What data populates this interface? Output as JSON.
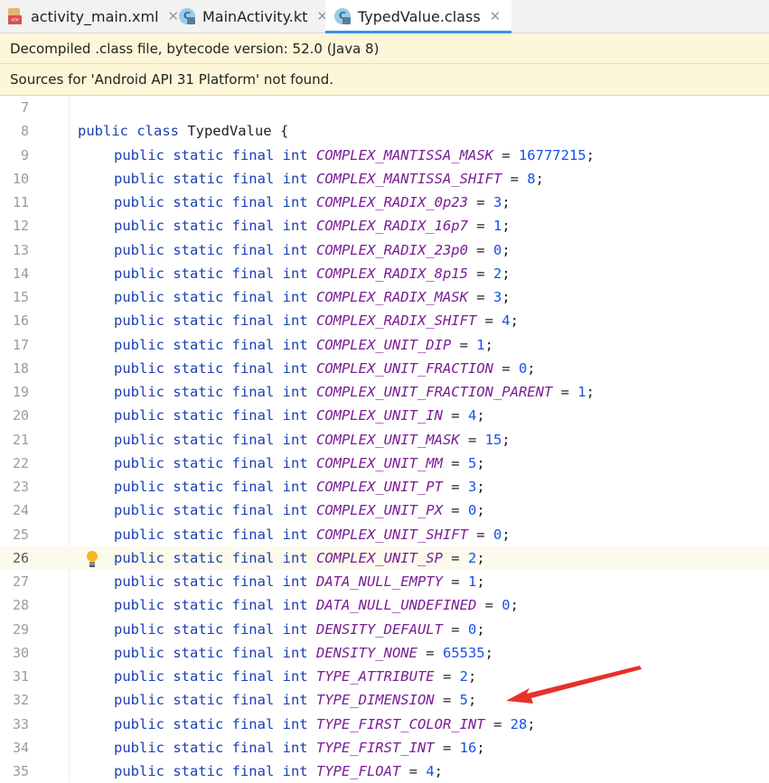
{
  "tabs": [
    {
      "label": "activity_main.xml",
      "icon": "xml-file-icon",
      "active": false
    },
    {
      "label": "MainActivity.kt",
      "icon": "kotlin-class-icon",
      "active": false
    },
    {
      "label": "TypedValue.class",
      "icon": "class-file-icon",
      "active": true
    }
  ],
  "banners": {
    "decompiled": "Decompiled .class file, bytecode version: 52.0 (Java 8)",
    "sources": "Sources for 'Android API 31 Platform' not found."
  },
  "editor": {
    "class_decl": {
      "number": "8",
      "text": "public class TypedValue {"
    },
    "blank_line": {
      "number": "7"
    },
    "modifiers": "public static final int",
    "current_line": "26",
    "lines": [
      {
        "number": "9",
        "name": "COMPLEX_MANTISSA_MASK",
        "value": "16777215"
      },
      {
        "number": "10",
        "name": "COMPLEX_MANTISSA_SHIFT",
        "value": "8"
      },
      {
        "number": "11",
        "name": "COMPLEX_RADIX_0p23",
        "value": "3"
      },
      {
        "number": "12",
        "name": "COMPLEX_RADIX_16p7",
        "value": "1"
      },
      {
        "number": "13",
        "name": "COMPLEX_RADIX_23p0",
        "value": "0"
      },
      {
        "number": "14",
        "name": "COMPLEX_RADIX_8p15",
        "value": "2"
      },
      {
        "number": "15",
        "name": "COMPLEX_RADIX_MASK",
        "value": "3"
      },
      {
        "number": "16",
        "name": "COMPLEX_RADIX_SHIFT",
        "value": "4"
      },
      {
        "number": "17",
        "name": "COMPLEX_UNIT_DIP",
        "value": "1"
      },
      {
        "number": "18",
        "name": "COMPLEX_UNIT_FRACTION",
        "value": "0"
      },
      {
        "number": "19",
        "name": "COMPLEX_UNIT_FRACTION_PARENT",
        "value": "1"
      },
      {
        "number": "20",
        "name": "COMPLEX_UNIT_IN",
        "value": "4"
      },
      {
        "number": "21",
        "name": "COMPLEX_UNIT_MASK",
        "value": "15"
      },
      {
        "number": "22",
        "name": "COMPLEX_UNIT_MM",
        "value": "5"
      },
      {
        "number": "23",
        "name": "COMPLEX_UNIT_PT",
        "value": "3"
      },
      {
        "number": "24",
        "name": "COMPLEX_UNIT_PX",
        "value": "0"
      },
      {
        "number": "25",
        "name": "COMPLEX_UNIT_SHIFT",
        "value": "0"
      },
      {
        "number": "26",
        "name": "COMPLEX_UNIT_SP",
        "value": "2"
      },
      {
        "number": "27",
        "name": "DATA_NULL_EMPTY",
        "value": "1"
      },
      {
        "number": "28",
        "name": "DATA_NULL_UNDEFINED",
        "value": "0"
      },
      {
        "number": "29",
        "name": "DENSITY_DEFAULT",
        "value": "0"
      },
      {
        "number": "30",
        "name": "DENSITY_NONE",
        "value": "65535"
      },
      {
        "number": "31",
        "name": "TYPE_ATTRIBUTE",
        "value": "2"
      },
      {
        "number": "32",
        "name": "TYPE_DIMENSION",
        "value": "5"
      },
      {
        "number": "33",
        "name": "TYPE_FIRST_COLOR_INT",
        "value": "28"
      },
      {
        "number": "34",
        "name": "TYPE_FIRST_INT",
        "value": "16"
      },
      {
        "number": "35",
        "name": "TYPE_FLOAT",
        "value": "4"
      }
    ]
  },
  "annotation": {
    "type": "arrow",
    "color": "#e8302a",
    "points_to_line": "32"
  },
  "colors": {
    "keyword": "#1b3eb3",
    "constant": "#7a1d96",
    "number": "#1750eb",
    "banner_bg": "#fdf6d8",
    "current_line_bg": "#fcfaed",
    "active_tab_underline": "#3d8fe0"
  }
}
